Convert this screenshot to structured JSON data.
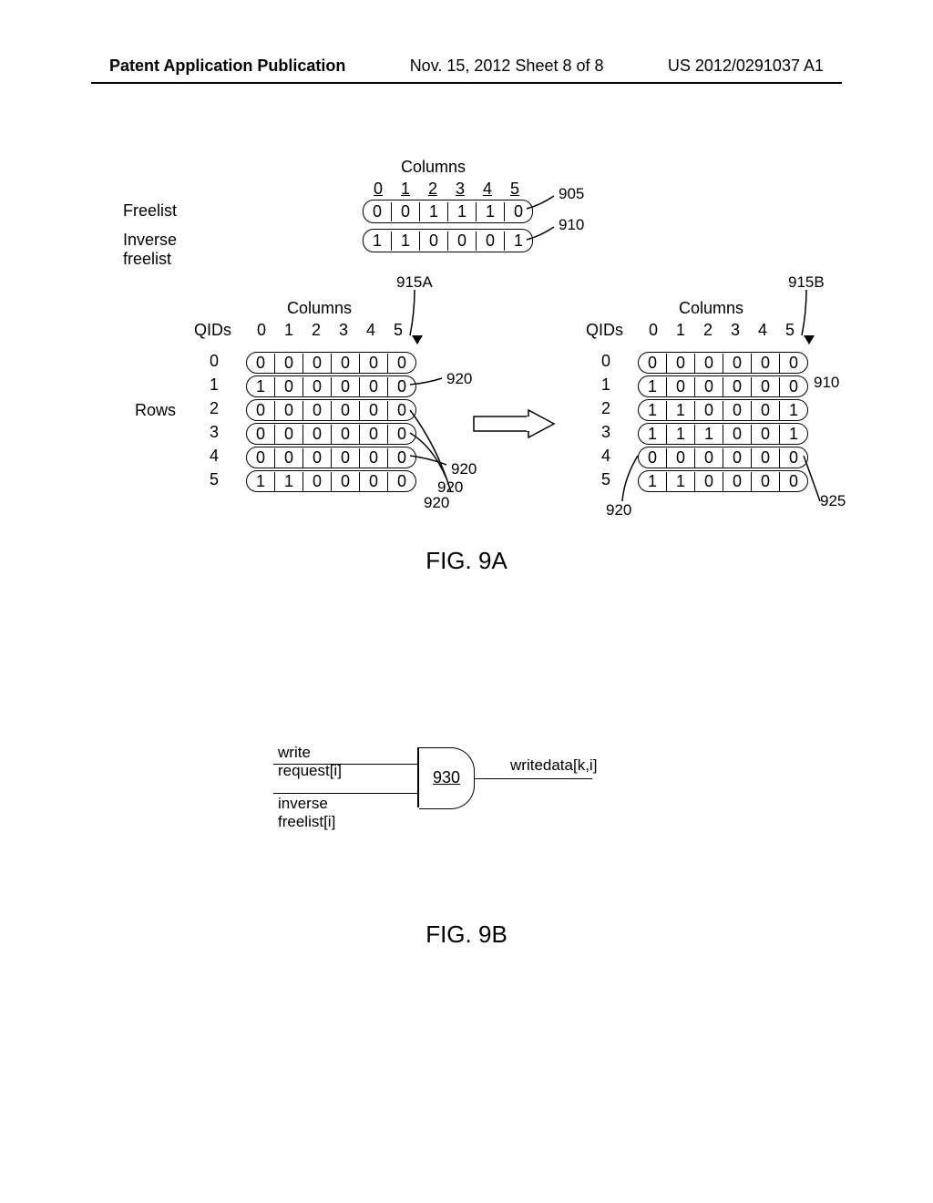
{
  "header": {
    "left": "Patent Application Publication",
    "center": "Nov. 15, 2012  Sheet 8 of 8",
    "right": "US 2012/0291037 A1"
  },
  "fig9a": {
    "columns_label": "Columns",
    "freelist_label": "Freelist",
    "inverse_freelist_label": "Inverse freelist",
    "qids_label": "QIDs",
    "rows_label": "Rows",
    "caption": "FIG. 9A",
    "col_indices": [
      "0",
      "1",
      "2",
      "3",
      "4",
      "5"
    ],
    "freelist": [
      "0",
      "0",
      "1",
      "1",
      "1",
      "0"
    ],
    "inverse_freelist": [
      "1",
      "1",
      "0",
      "0",
      "0",
      "1"
    ],
    "callout_905": "905",
    "callout_910": "910",
    "callout_915A": "915A",
    "callout_915B": "915B",
    "callout_920": "920",
    "callout_925": "925",
    "row_indices": [
      "0",
      "1",
      "2",
      "3",
      "4",
      "5"
    ],
    "matrixA": [
      [
        "0",
        "0",
        "0",
        "0",
        "0",
        "0"
      ],
      [
        "1",
        "0",
        "0",
        "0",
        "0",
        "0"
      ],
      [
        "0",
        "0",
        "0",
        "0",
        "0",
        "0"
      ],
      [
        "0",
        "0",
        "0",
        "0",
        "0",
        "0"
      ],
      [
        "0",
        "0",
        "0",
        "0",
        "0",
        "0"
      ],
      [
        "1",
        "1",
        "0",
        "0",
        "0",
        "0"
      ]
    ],
    "matrixB": [
      [
        "0",
        "0",
        "0",
        "0",
        "0",
        "0"
      ],
      [
        "1",
        "0",
        "0",
        "0",
        "0",
        "0"
      ],
      [
        "1",
        "1",
        "0",
        "0",
        "0",
        "1"
      ],
      [
        "1",
        "1",
        "1",
        "0",
        "0",
        "1"
      ],
      [
        "0",
        "0",
        "0",
        "0",
        "0",
        "0"
      ],
      [
        "1",
        "1",
        "0",
        "0",
        "0",
        "0"
      ]
    ]
  },
  "fig9b": {
    "caption": "FIG. 9B",
    "input1": "write request[i]",
    "input2": "inverse freelist[i]",
    "output": "writedata[k,i]",
    "gate_label": "930"
  },
  "chart_data": [
    {
      "type": "table",
      "title": "Freelist / Inverse freelist bit vectors",
      "columns": [
        0,
        1,
        2,
        3,
        4,
        5
      ],
      "freelist": [
        0,
        0,
        1,
        1,
        1,
        0
      ],
      "inverse_freelist": [
        1,
        1,
        0,
        0,
        0,
        1
      ]
    },
    {
      "type": "table",
      "title": "QID matrix 915A (before)",
      "columns": [
        0,
        1,
        2,
        3,
        4,
        5
      ],
      "rows": [
        0,
        1,
        2,
        3,
        4,
        5
      ],
      "values": [
        [
          0,
          0,
          0,
          0,
          0,
          0
        ],
        [
          1,
          0,
          0,
          0,
          0,
          0
        ],
        [
          0,
          0,
          0,
          0,
          0,
          0
        ],
        [
          0,
          0,
          0,
          0,
          0,
          0
        ],
        [
          0,
          0,
          0,
          0,
          0,
          0
        ],
        [
          1,
          1,
          0,
          0,
          0,
          0
        ]
      ]
    },
    {
      "type": "table",
      "title": "QID matrix 915B (after)",
      "columns": [
        0,
        1,
        2,
        3,
        4,
        5
      ],
      "rows": [
        0,
        1,
        2,
        3,
        4,
        5
      ],
      "values": [
        [
          0,
          0,
          0,
          0,
          0,
          0
        ],
        [
          1,
          0,
          0,
          0,
          0,
          0
        ],
        [
          1,
          1,
          0,
          0,
          0,
          1
        ],
        [
          1,
          1,
          1,
          0,
          0,
          1
        ],
        [
          0,
          0,
          0,
          0,
          0,
          0
        ],
        [
          1,
          1,
          0,
          0,
          0,
          0
        ]
      ]
    }
  ]
}
